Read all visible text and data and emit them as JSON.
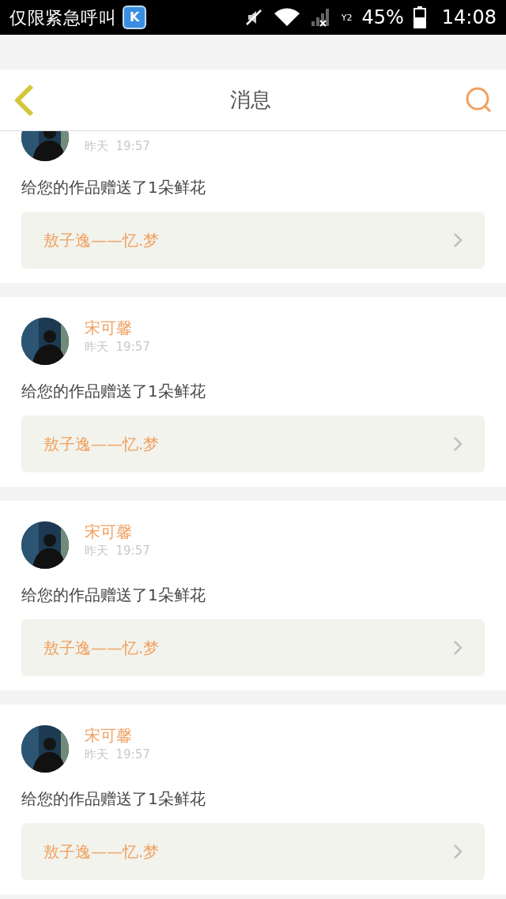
{
  "status_bar": {
    "carrier": "仅限紧急呼叫",
    "app_icon_letter": "K",
    "sim_label": "Y2",
    "battery": "45%",
    "time": "14:08"
  },
  "header": {
    "title": "消息"
  },
  "messages": [
    {
      "clipped": true,
      "time": "昨天  19:57",
      "text": "给您的作品赠送了1朵鲜花",
      "work": "敖子逸——忆.梦"
    },
    {
      "clipped": false,
      "name": "宋可馨",
      "time": "昨天  19:57",
      "text": "给您的作品赠送了1朵鲜花",
      "work": "敖子逸——忆.梦"
    },
    {
      "clipped": false,
      "name": "宋可馨",
      "time": "昨天  19:57",
      "text": "给您的作品赠送了1朵鲜花",
      "work": "敖子逸——忆.梦"
    },
    {
      "clipped": false,
      "name": "宋可馨",
      "time": "昨天  19:57",
      "text": "给您的作品赠送了1朵鲜花",
      "work": "敖子逸——忆.梦"
    }
  ]
}
